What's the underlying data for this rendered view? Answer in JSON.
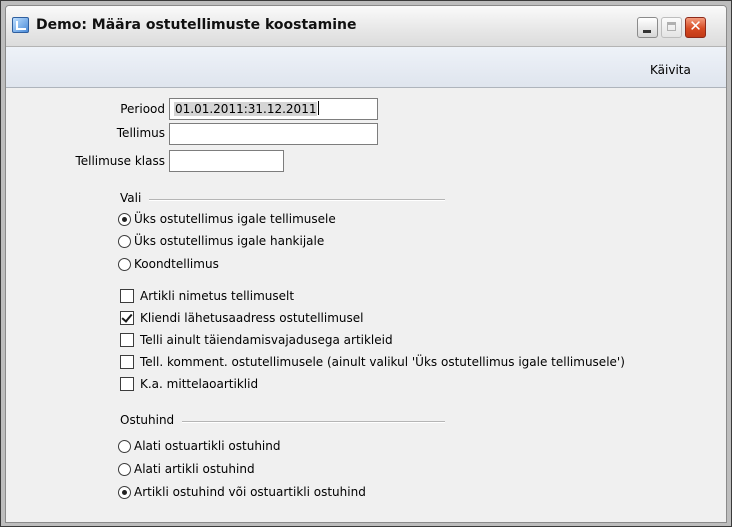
{
  "window": {
    "title": "Demo: Määra ostutellimuste koostamine",
    "icon": "app-window-icon"
  },
  "toolbar": {
    "run_label": "Käivita"
  },
  "form": {
    "period_label": "Periood",
    "period_value": "01.01.2011:31.12.2011",
    "order_label": "Tellimus",
    "order_value": "",
    "order_class_label": "Tellimuse klass",
    "order_class_value": ""
  },
  "vali": {
    "label": "Vali",
    "options": [
      {
        "label": "Üks ostutellimus igale tellimusele",
        "checked": true
      },
      {
        "label": "Üks ostutellimus igale hankijale",
        "checked": false
      },
      {
        "label": "Koondtellimus",
        "checked": false
      }
    ]
  },
  "checkboxes": [
    {
      "label": "Artikli nimetus tellimuselt",
      "checked": false
    },
    {
      "label": "Kliendi lähetusaadress ostutellimusel",
      "checked": true
    },
    {
      "label": "Telli ainult täiendamisvajadusega artikleid",
      "checked": false
    },
    {
      "label": "Tell. komment. ostutellimusele (ainult valikul 'Üks ostutellimus igale tellimusele')",
      "checked": false
    },
    {
      "label": "K.a. mittelaoartiklid",
      "checked": false
    }
  ],
  "ostuhind": {
    "label": "Ostuhind",
    "options": [
      {
        "label": "Alati ostuartikli ostuhind",
        "checked": false
      },
      {
        "label": "Alati artikli ostuhind",
        "checked": false
      },
      {
        "label": "Artikli ostuhind või ostuartikli ostuhind",
        "checked": true
      }
    ]
  }
}
